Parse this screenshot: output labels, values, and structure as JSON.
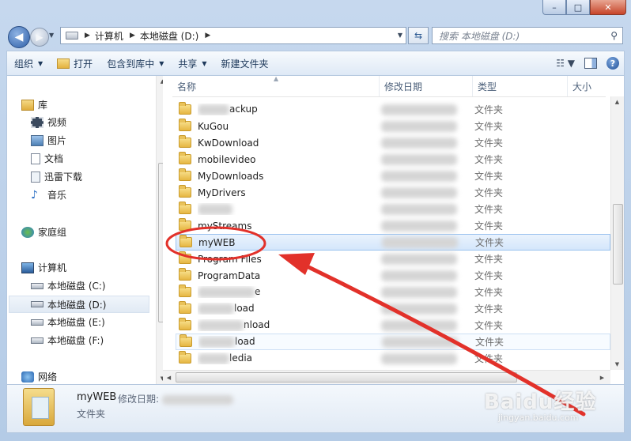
{
  "window": {
    "caption_min": "–",
    "caption_max": "□",
    "caption_close": "✕"
  },
  "address": {
    "segments": [
      "计算机",
      "本地磁盘 (D:)"
    ],
    "search_placeholder": "搜索 本地磁盘 (D:)"
  },
  "toolbar": {
    "organize": "组织",
    "open": "打开",
    "include_in_library": "包含到库中",
    "share": "共享",
    "new_folder": "新建文件夹"
  },
  "nav": {
    "library": "库",
    "videos": "视频",
    "pictures": "图片",
    "documents": "文档",
    "thunder": "迅雷下载",
    "music": "音乐",
    "homegroup": "家庭组",
    "computer": "计算机",
    "drive_c": "本地磁盘 (C:)",
    "drive_d": "本地磁盘 (D:)",
    "drive_e": "本地磁盘 (E:)",
    "drive_f": "本地磁盘 (F:)",
    "network": "网络"
  },
  "columns": {
    "name": "名称",
    "modified": "修改日期",
    "type": "类型",
    "size": "大小"
  },
  "files": [
    {
      "name": "ackup",
      "type": "文件夹"
    },
    {
      "name": "KuGou",
      "type": "文件夹"
    },
    {
      "name": "KwDownload",
      "type": "文件夹"
    },
    {
      "name": "mobilevideo",
      "type": "文件夹"
    },
    {
      "name": "MyDownloads",
      "type": "文件夹"
    },
    {
      "name": "MyDrivers",
      "type": "文件夹"
    },
    {
      "name": "",
      "type": "文件夹"
    },
    {
      "name": "myStreams",
      "type": "文件夹"
    },
    {
      "name": "myWEB",
      "type": "文件夹"
    },
    {
      "name": "Program Files",
      "type": "文件夹"
    },
    {
      "name": "ProgramData",
      "type": "文件夹"
    },
    {
      "name": "e",
      "type": "文件夹"
    },
    {
      "name": "load",
      "type": "文件夹"
    },
    {
      "name": "nload",
      "type": "文件夹"
    },
    {
      "name": "load",
      "type": "文件夹"
    },
    {
      "name": "ledia",
      "type": "文件夹"
    }
  ],
  "details": {
    "name": "myWEB",
    "modified_label": "修改日期:",
    "type": "文件夹"
  },
  "watermark": {
    "text": "Baidu经验",
    "sub": "jingyan.baidu.com"
  }
}
